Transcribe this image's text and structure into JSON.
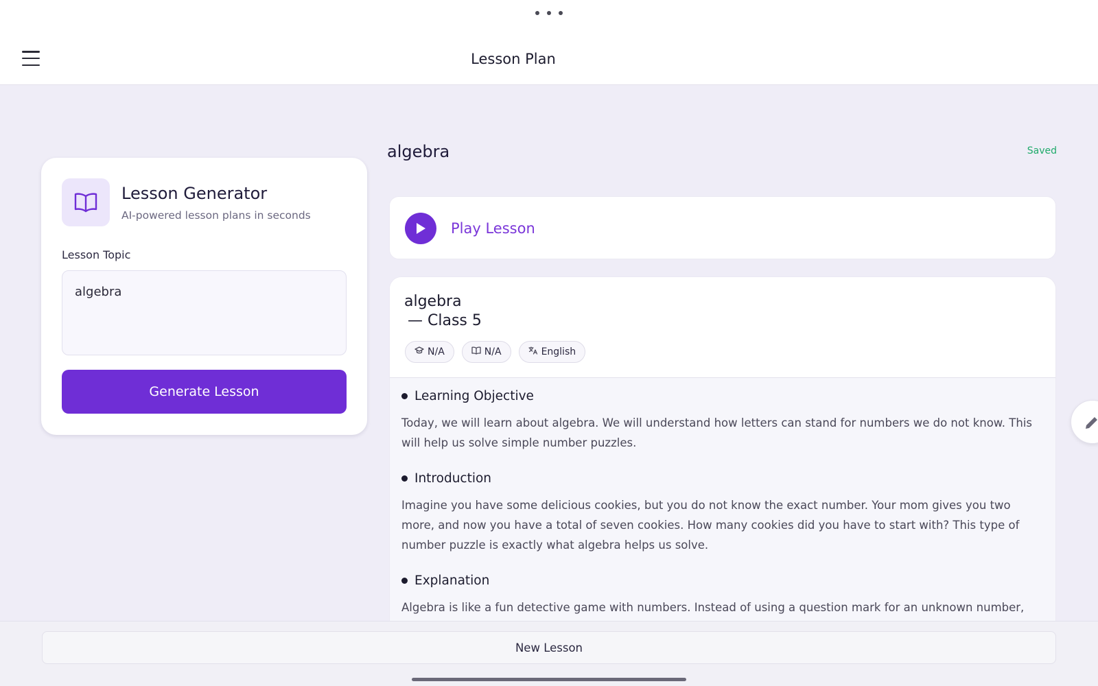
{
  "header": {
    "title": "Lesson Plan",
    "menu_icon": "hamburger-menu-icon",
    "more_icon": "ellipsis-icon"
  },
  "generator": {
    "title": "Lesson Generator",
    "subtitle": "AI-powered lesson plans in seconds",
    "icon": "open-book-icon",
    "topic_label": "Lesson Topic",
    "topic_value": "algebra",
    "generate_label": "Generate Lesson"
  },
  "lesson": {
    "heading": "algebra",
    "saved_label": "Saved",
    "play_label": "Play Lesson",
    "title": "algebra",
    "class_line": "— Class 5",
    "chips": [
      {
        "icon": "graduation-cap-icon",
        "label": "N/A"
      },
      {
        "icon": "book-icon",
        "label": "N/A"
      },
      {
        "icon": "translate-icon",
        "label": "English"
      }
    ],
    "sections": [
      {
        "heading": "Learning Objective",
        "text": "Today, we will learn about algebra. We will understand how letters can stand for numbers we do not know. This will help us solve simple number puzzles."
      },
      {
        "heading": "Introduction",
        "text": "Imagine you have some delicious cookies, but you do not know the exact number. Your mom gives you two more, and now you have a total of seven cookies. How many cookies did you have to start with? This type of number puzzle is exactly what algebra helps us solve."
      },
      {
        "heading": "Explanation",
        "text": "Algebra is like a fun detective game with numbers. Instead of using a question mark for an unknown number,"
      }
    ]
  },
  "footer": {
    "new_lesson_label": "New Lesson"
  },
  "colors": {
    "accent": "#6f2ed6",
    "saved": "#1faa6a",
    "background": "#efedf7"
  }
}
